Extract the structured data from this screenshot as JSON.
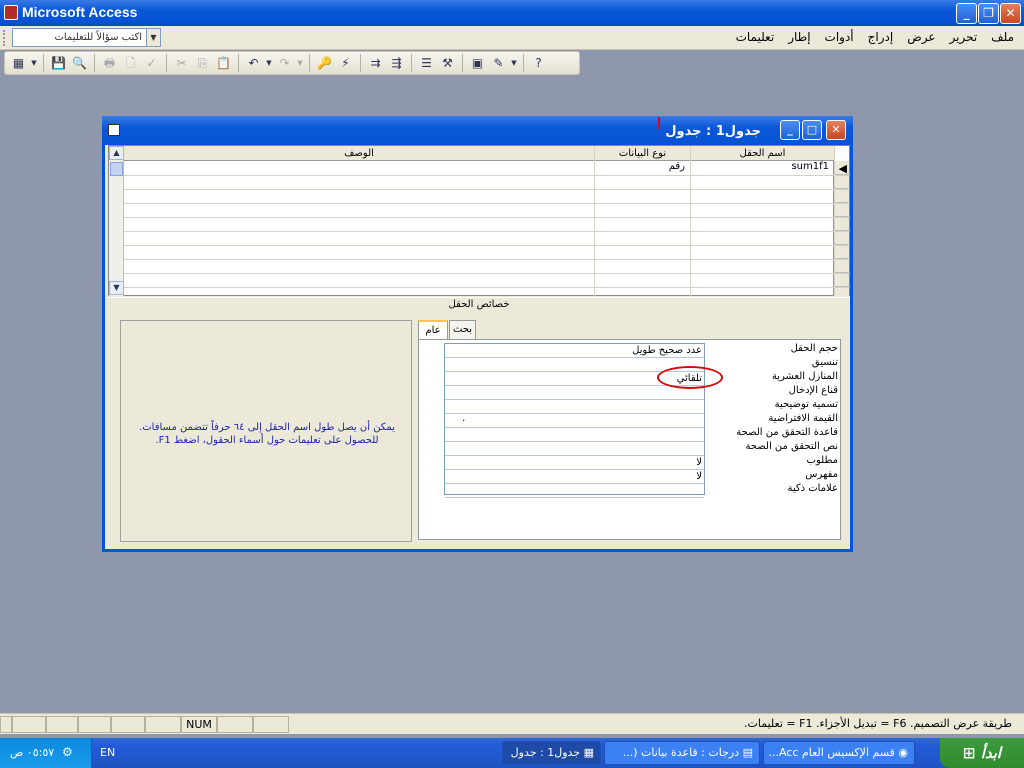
{
  "app": {
    "title": "Microsoft Access"
  },
  "menu": {
    "items": [
      "ملف",
      "تحرير",
      "عرض",
      "إدراج",
      "أدوات",
      "إطار",
      "تعليمات"
    ]
  },
  "help_box": {
    "placeholder": "اكتب سؤالاً للتعليمات"
  },
  "window": {
    "title": "جدول1 : جدول"
  },
  "grid": {
    "headers": {
      "field_name": "اسم الحقل",
      "data_type": "نوع البيانات",
      "description": "الوصف"
    },
    "rows": [
      {
        "field_name": "sum1f1",
        "data_type": "رقم",
        "description": ""
      }
    ]
  },
  "properties": {
    "section_label": "خصائص الحقل",
    "tabs": {
      "general": "عام",
      "lookup": "بحث"
    },
    "labels": [
      "حجم الحقل",
      "تنسيق",
      "المنازل العشرية",
      "قناع الإدخال",
      "تسمية توضيحية",
      "القيمة الافتراضية",
      "قاعدة التحقق من الصحة",
      "نص التحقق من الصحة",
      "مطلوب",
      "مفهرس",
      "علامات ذكية"
    ],
    "values": [
      "عدد صحيح طويل",
      "",
      "تلقائي",
      "",
      "",
      "٠",
      "",
      "",
      "لا",
      "لا",
      ""
    ],
    "help_text": "يمكن أن يصل طول اسم الحقل إلى ٦٤ حرفاً تتضمن مسافات. للحصول على تعليمات حول أسماء الحقول، اضغط F1."
  },
  "status": {
    "text": "طريقة عرض التصميم. F6 = تبديل الأجزاء. F1 = تعليمات.",
    "num": "NUM"
  },
  "taskbar": {
    "start": "ابدأ",
    "tasks": [
      "قسم الإكسيس العام Acc...",
      "درجات : قاعدة بيانات (...",
      "جدول1 : جدول"
    ],
    "lang": "EN",
    "clock": "٠٥:٥٧ ص"
  }
}
